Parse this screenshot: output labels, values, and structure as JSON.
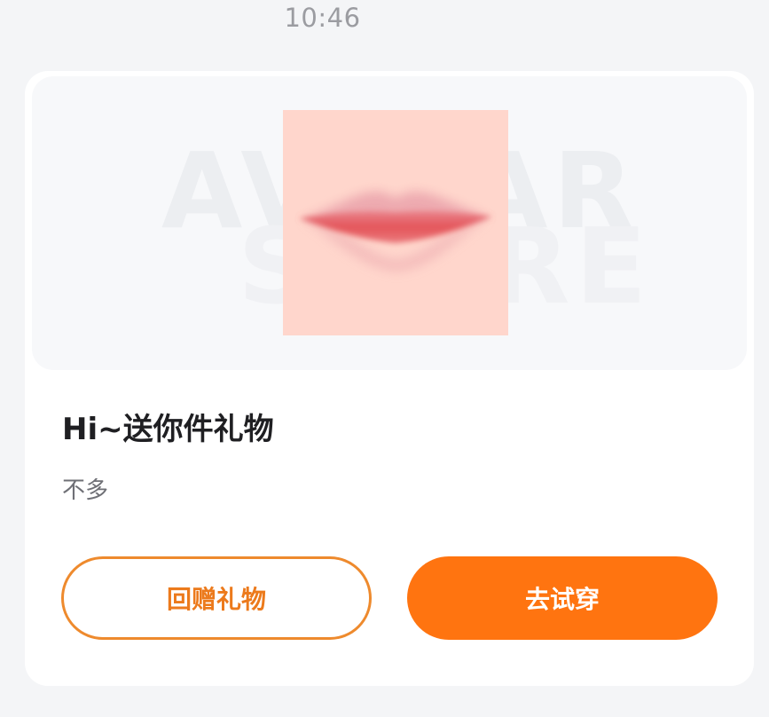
{
  "message": {
    "timestamp": "10:46"
  },
  "card": {
    "preview": {
      "watermark_line1": "AVATAR",
      "watermark_line2": "STORE",
      "item_icon": "lips-icon",
      "colors": {
        "item_background": "#ffd6cc",
        "lips": "#e55a5e"
      }
    },
    "title": "Hi~送你件礼物",
    "subtitle": "不多",
    "buttons": {
      "return_gift_label": "回赠礼物",
      "try_on_label": "去试穿"
    },
    "colors": {
      "accent": "#ff7410",
      "accent_outline": "#ee8a2d"
    }
  }
}
